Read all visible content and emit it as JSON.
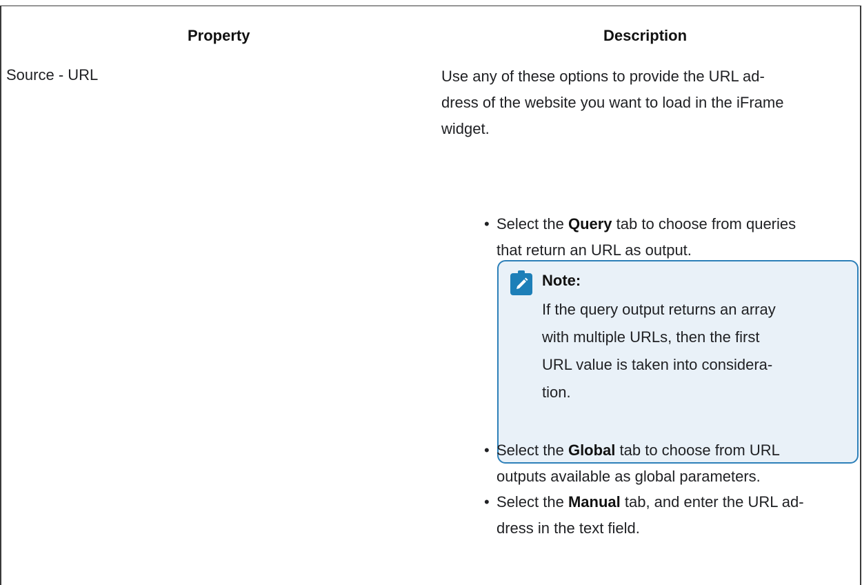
{
  "table": {
    "headers": {
      "property": "Property",
      "description": "Description"
    },
    "row": {
      "property": "Source - URL",
      "description_intro": {
        "line1": "Use any of these options to provide the URL ad-",
        "line2": "dress of the website you want to load in the iFrame",
        "line3": "widget."
      },
      "bullets": [
        {
          "prefix": "Select the ",
          "bold": "Query",
          "line1_rest": " tab to choose from queries",
          "line2": "that return an URL as output."
        },
        {
          "prefix": "Select the ",
          "bold": "Global",
          "line1_rest": " tab to choose from URL",
          "line2": "outputs available as global parameters."
        },
        {
          "prefix": "Select the ",
          "bold": "Manual",
          "line1_rest": " tab, and enter the URL ad-",
          "line2": "dress in the text field."
        }
      ],
      "note": {
        "title": "Note:",
        "lines": [
          "If the query output returns an array",
          "with multiple URLs, then the first",
          "URL value is taken into considera-",
          "tion."
        ]
      }
    }
  },
  "colors": {
    "note_bg": "#e9f1f8",
    "note_border": "#2c7fb8",
    "note_icon": "#1d7fb8"
  },
  "icons": {
    "note_icon": "note-pencil-icon"
  }
}
